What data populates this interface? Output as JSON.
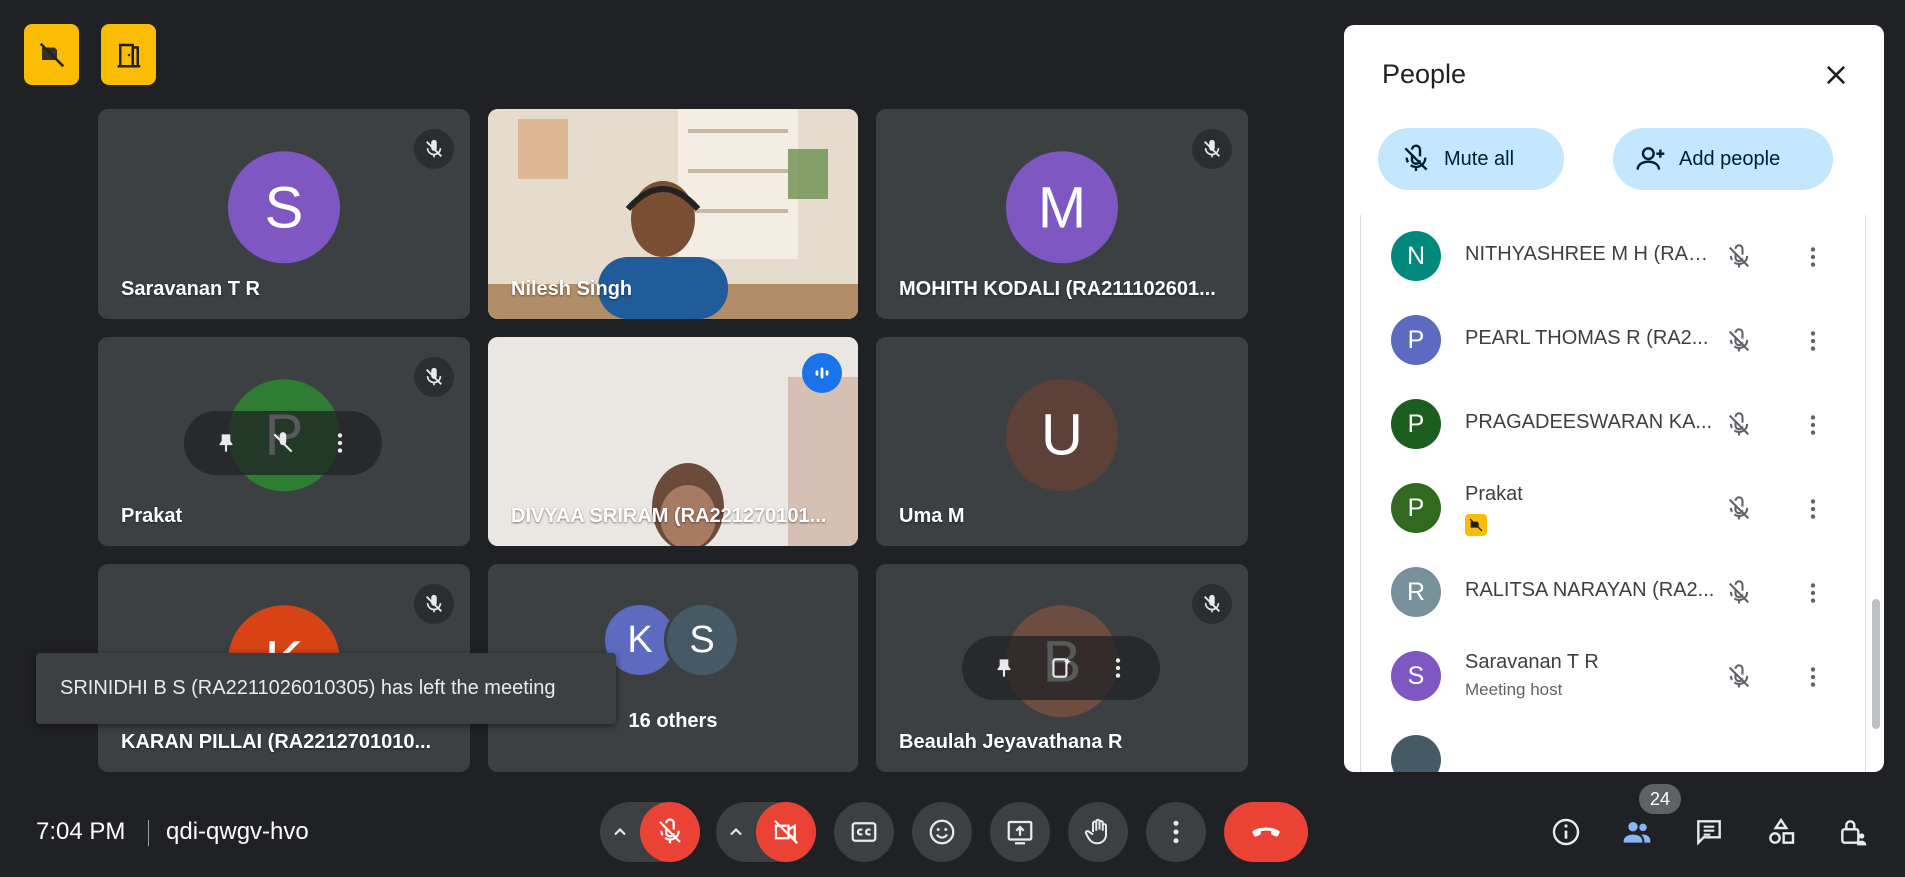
{
  "meeting": {
    "time": "7:04 PM",
    "code": "qdi-qwgv-hvo"
  },
  "tiles": [
    {
      "name": "Saravanan T R",
      "initial": "S",
      "color": "#7e57c2"
    },
    {
      "name": "Nilesh Singh"
    },
    {
      "name": "MOHITH KODALI (RA211102601...",
      "initial": "M",
      "color": "#7e57c2"
    },
    {
      "name": "Prakat",
      "initial": "P",
      "color": "#2e7d32"
    },
    {
      "name": "DIVYAA SRIRAM (RA221270101..."
    },
    {
      "name": "Uma M",
      "initial": "U",
      "color": "#5d4037"
    },
    {
      "name": "KARAN PILLAI (RA2212701010...",
      "initial": "K",
      "color": "#d84315"
    },
    {
      "name": "16 others",
      "avatars": [
        "K",
        "S"
      ],
      "avatar_colors": [
        "#5c6bc0",
        "#455a64"
      ]
    },
    {
      "name": "Beaulah Jeyavathana R",
      "initial": "B",
      "color": "#6d4c41"
    }
  ],
  "toast": {
    "text": "SRINIDHI B S (RA2211026010305) has left the meeting"
  },
  "panel": {
    "title": "People",
    "mute_all": "Mute all",
    "add_people": "Add people",
    "people": [
      {
        "initial": "N",
        "name": "NITHYASHREE M H (RA2...",
        "color": "#00897b"
      },
      {
        "initial": "P",
        "name": "PEARL THOMAS R (RA2...",
        "color": "#5c6bc0"
      },
      {
        "initial": "P",
        "name": "PRAGADEESWARAN KA...",
        "color": "#1b5e20"
      },
      {
        "initial": "P",
        "name": "Prakat",
        "color": "#33691e"
      },
      {
        "initial": "R",
        "name": "RALITSA NARAYAN (RA2...",
        "color": "#78909c"
      },
      {
        "initial": "S",
        "name": "Saravanan T R",
        "sub": "Meeting host",
        "color": "#7e57c2"
      }
    ]
  },
  "people_count": "24",
  "colors": {
    "background": "#202124",
    "tile": "#3c4043",
    "accent_red": "#ea4335",
    "badge_yellow": "#fbbc04",
    "pill_blue": "#c2e7ff",
    "speaking_blue": "#1a73e8"
  }
}
